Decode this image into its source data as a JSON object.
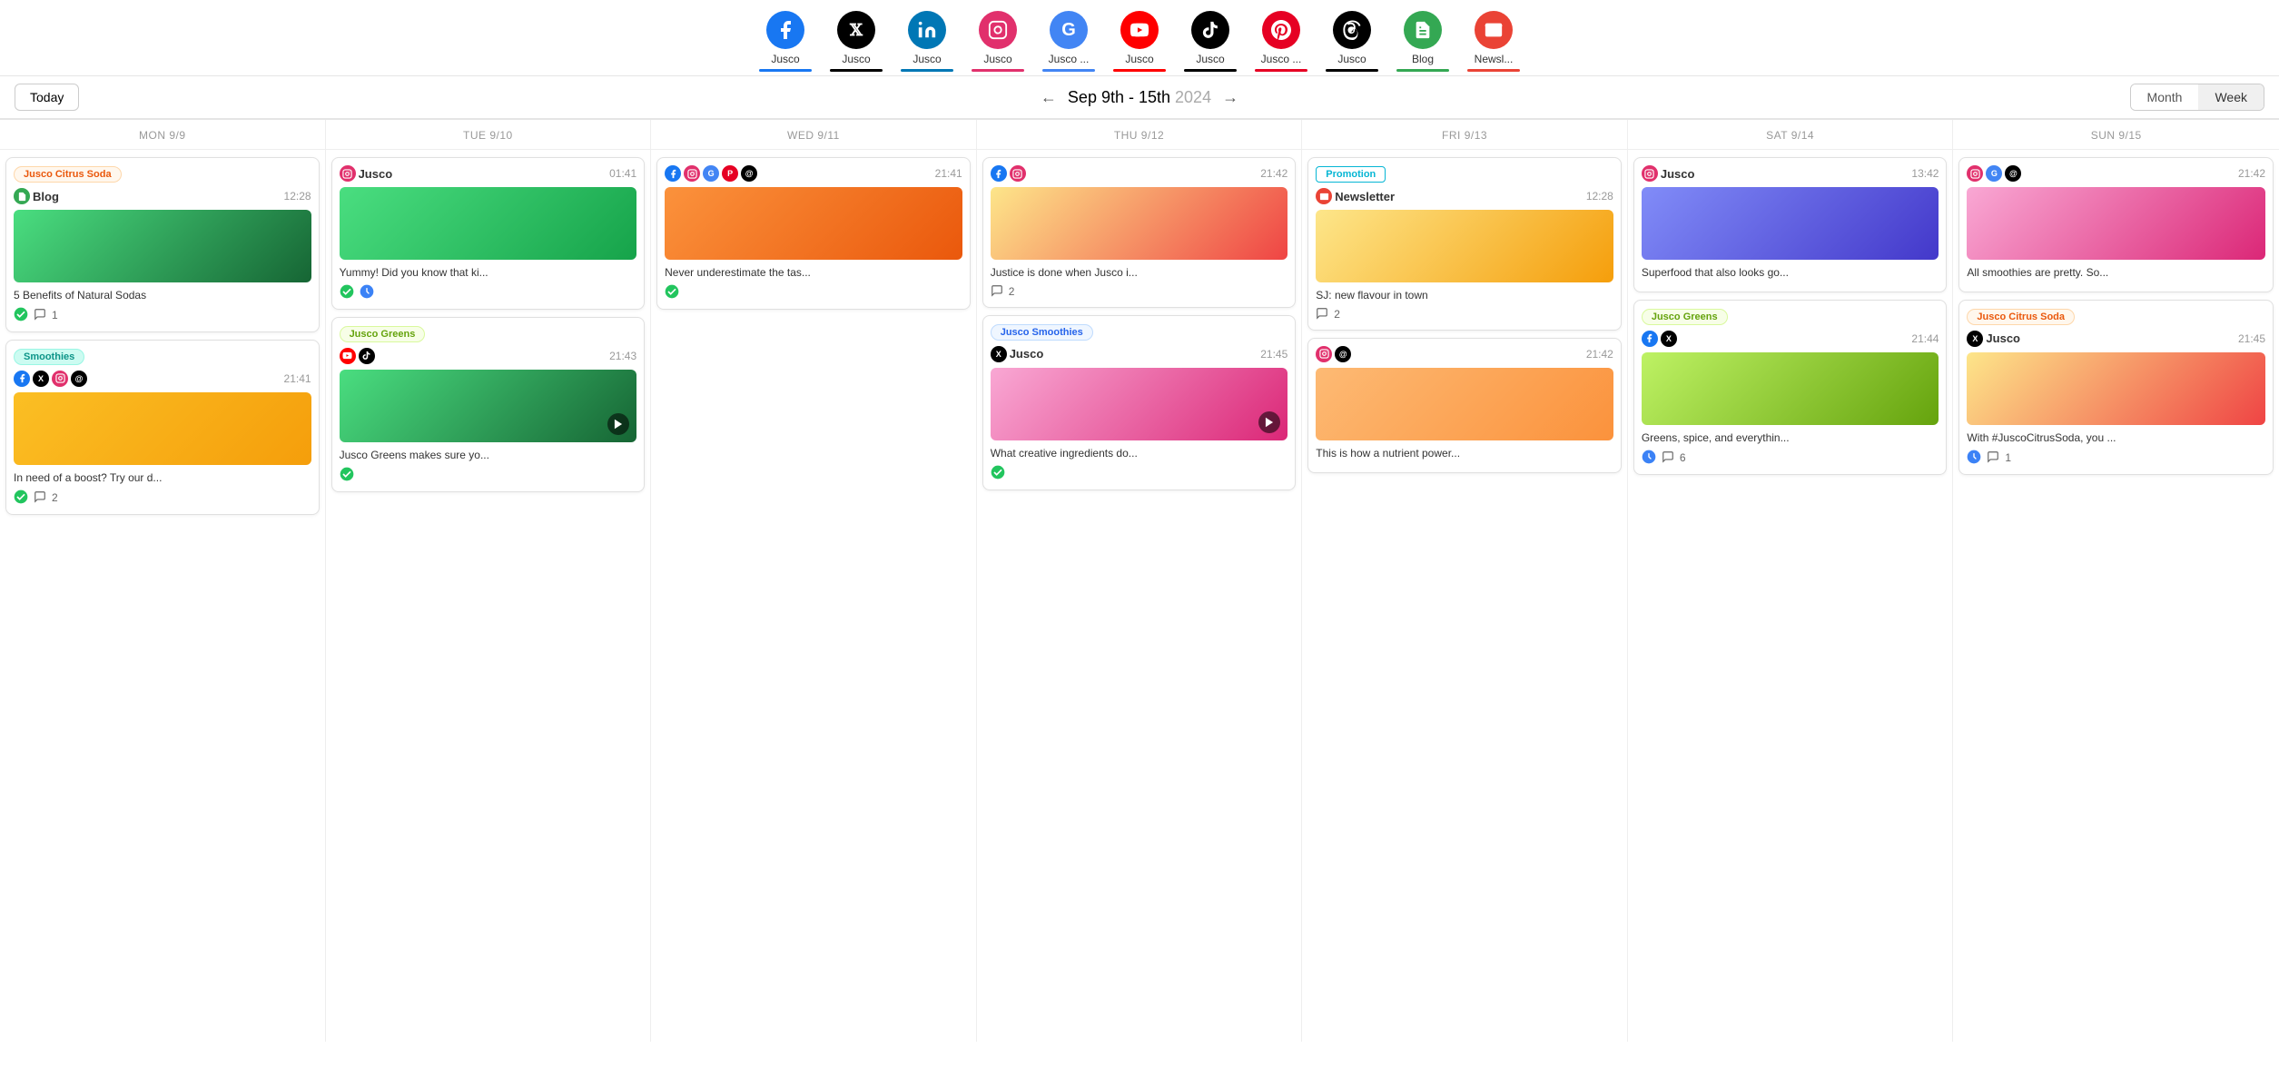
{
  "channels": [
    {
      "name": "Facebook",
      "label": "Jusco",
      "icon": "f",
      "bg": "#1877f2",
      "underline": "#1877f2",
      "symbol": "𝐟"
    },
    {
      "name": "X",
      "label": "Jusco",
      "icon": "X",
      "bg": "#000",
      "underline": "#000"
    },
    {
      "name": "LinkedIn",
      "label": "Jusco",
      "icon": "in",
      "bg": "#0077b5",
      "underline": "#0077b5"
    },
    {
      "name": "Instagram",
      "label": "Jusco",
      "icon": "📷",
      "bg": "#e1306c",
      "underline": "#e1306c"
    },
    {
      "name": "Google",
      "label": "Jusco ...",
      "icon": "G",
      "bg": "#4285f4",
      "underline": "#4285f4"
    },
    {
      "name": "YouTube",
      "label": "Jusco",
      "icon": "▶",
      "bg": "#ff0000",
      "underline": "#ff0000"
    },
    {
      "name": "TikTok",
      "label": "Jusco",
      "icon": "♪",
      "bg": "#000",
      "underline": "#000"
    },
    {
      "name": "Pinterest",
      "label": "Jusco ...",
      "icon": "P",
      "bg": "#e60023",
      "underline": "#e60023"
    },
    {
      "name": "Threads",
      "label": "Jusco",
      "icon": "@",
      "bg": "#000",
      "underline": "#000"
    },
    {
      "name": "Blog",
      "label": "Blog",
      "icon": "B",
      "bg": "#34a853",
      "underline": "#34a853"
    },
    {
      "name": "Newsletter",
      "label": "Newsl...",
      "icon": "✉",
      "bg": "#ea4335",
      "underline": "#ea4335"
    }
  ],
  "nav": {
    "today_label": "Today",
    "date_range": "Sep 9th - 15th",
    "year": "2024",
    "month_label": "Month",
    "week_label": "Week",
    "active_view": "Week"
  },
  "days": [
    {
      "label": "MON 9/9"
    },
    {
      "label": "TUE 9/10"
    },
    {
      "label": "WED 9/11"
    },
    {
      "label": "THU 9/12"
    },
    {
      "label": "FRI 9/13"
    },
    {
      "label": "SAT 9/14"
    },
    {
      "label": "SUN 9/15"
    }
  ],
  "cards": {
    "mon": [
      {
        "id": "mon-1",
        "tag": "Jusco Citrus Soda",
        "tagClass": "tag-orange",
        "icons": [
          {
            "type": "blog",
            "bg": "#34a853",
            "text": "B"
          }
        ],
        "account": "Blog",
        "time": "12:28",
        "imgClass": "img-detox",
        "text": "5 Benefits of Natural Sodas",
        "hasCheck": true,
        "comments": 1
      },
      {
        "id": "mon-2",
        "tag": "Smoothies",
        "tagClass": "tag-teal",
        "icons": [
          {
            "type": "facebook",
            "bg": "#1877f2",
            "text": "f"
          },
          {
            "type": "x",
            "bg": "#000",
            "text": "X"
          },
          {
            "type": "instagram",
            "bg": "#e1306c",
            "text": "📷"
          },
          {
            "type": "threads",
            "bg": "#000",
            "text": "@"
          }
        ],
        "time": "21:41",
        "imgClass": "img-smoothie",
        "text": "In need of a boost? Try our d...",
        "hasCheck": true,
        "comments": 2
      }
    ],
    "tue": [
      {
        "id": "tue-1",
        "icons": [
          {
            "type": "instagram",
            "bg": "#e1306c",
            "text": "📷"
          }
        ],
        "account": "Jusco",
        "time": "01:41",
        "imgClass": "img-kiwi",
        "text": "Yummy! Did you know that ki...",
        "hasCheck": true,
        "hasSchedule": true
      },
      {
        "id": "tue-2",
        "tag": "Jusco Greens",
        "tagClass": "tag-lime",
        "icons": [
          {
            "type": "youtube",
            "bg": "#ff0000",
            "text": "▶"
          },
          {
            "type": "tiktok",
            "bg": "#000",
            "text": "♪"
          }
        ],
        "time": "21:43",
        "imgClass": "img-avocado",
        "hasVideo": true,
        "text": "Jusco Greens makes sure yo...",
        "hasCheck": true
      }
    ],
    "wed": [
      {
        "id": "wed-1",
        "icons": [
          {
            "type": "facebook",
            "bg": "#1877f2",
            "text": "f"
          },
          {
            "type": "instagram",
            "bg": "#e1306c",
            "text": "📷"
          },
          {
            "type": "google",
            "bg": "#4285f4",
            "text": "G"
          },
          {
            "type": "pinterest",
            "bg": "#e60023",
            "text": "P"
          },
          {
            "type": "threads",
            "bg": "#000",
            "text": "@"
          }
        ],
        "time": "21:41",
        "imgClass": "img-orange",
        "text": "Never underestimate the tas...",
        "hasCheck": true
      }
    ],
    "thu": [
      {
        "id": "thu-1",
        "icons": [
          {
            "type": "facebook",
            "bg": "#1877f2",
            "text": "f"
          },
          {
            "type": "instagram",
            "bg": "#e1306c",
            "text": "📷"
          }
        ],
        "time": "21:42",
        "imgClass": "img-citrus",
        "text": "Justice is done when Jusco i...",
        "comments": 2
      },
      {
        "id": "thu-2",
        "tag": "Jusco Smoothies",
        "tagClass": "tag-blue",
        "icons": [
          {
            "type": "x",
            "bg": "#000",
            "text": "X"
          }
        ],
        "account": "Jusco",
        "time": "21:45",
        "imgClass": "img-pink",
        "hasVideo": true,
        "text": "What creative ingredients do...",
        "hasCheck": true
      }
    ],
    "fri": [
      {
        "id": "fri-1",
        "isPromo": true,
        "promoLabel": "Promotion",
        "icons": [
          {
            "type": "newsletter",
            "bg": "#ea4335",
            "text": "✉"
          }
        ],
        "account": "Newsletter",
        "time": "12:28",
        "imgClass": "img-juice",
        "text": "SJ: new flavour in town",
        "comments": 2
      },
      {
        "id": "fri-2",
        "icons": [
          {
            "type": "instagram",
            "bg": "#e1306c",
            "text": "📷"
          },
          {
            "type": "threads",
            "bg": "#000",
            "text": "@"
          }
        ],
        "time": "21:42",
        "imgClass": "img-peach",
        "text": "This is how a nutrient power...",
        "hasSchedule": false
      }
    ],
    "sat": [
      {
        "id": "sat-1",
        "icons": [
          {
            "type": "instagram",
            "bg": "#e1306c",
            "text": "📷"
          }
        ],
        "account": "Jusco",
        "time": "13:42",
        "imgClass": "img-blueberry",
        "text": "Superfood that also looks go..."
      },
      {
        "id": "sat-2",
        "tag": "Jusco Greens",
        "tagClass": "tag-lime",
        "icons": [
          {
            "type": "facebook",
            "bg": "#1877f2",
            "text": "f"
          },
          {
            "type": "x",
            "bg": "#000",
            "text": "X"
          }
        ],
        "time": "21:44",
        "imgClass": "img-lime",
        "text": "Greens, spice, and everythin...",
        "hasSchedule": true,
        "comments": 6
      }
    ],
    "sun": [
      {
        "id": "sun-1",
        "icons": [
          {
            "type": "instagram",
            "bg": "#e1306c",
            "text": "📷"
          },
          {
            "type": "google",
            "bg": "#4285f4",
            "text": "G"
          },
          {
            "type": "threads",
            "bg": "#000",
            "text": "@"
          }
        ],
        "time": "21:42",
        "imgClass": "img-pink",
        "text": "All smoothies are pretty. So..."
      },
      {
        "id": "sun-2",
        "tag": "Jusco Citrus Soda",
        "tagClass": "tag-orange",
        "icons": [
          {
            "type": "x",
            "bg": "#000",
            "text": "X"
          }
        ],
        "account": "Jusco",
        "time": "21:45",
        "imgClass": "img-citrus",
        "text": "With #JuscoCitrusSoda, you ...",
        "hasSchedule": true,
        "comments": 1
      }
    ]
  }
}
